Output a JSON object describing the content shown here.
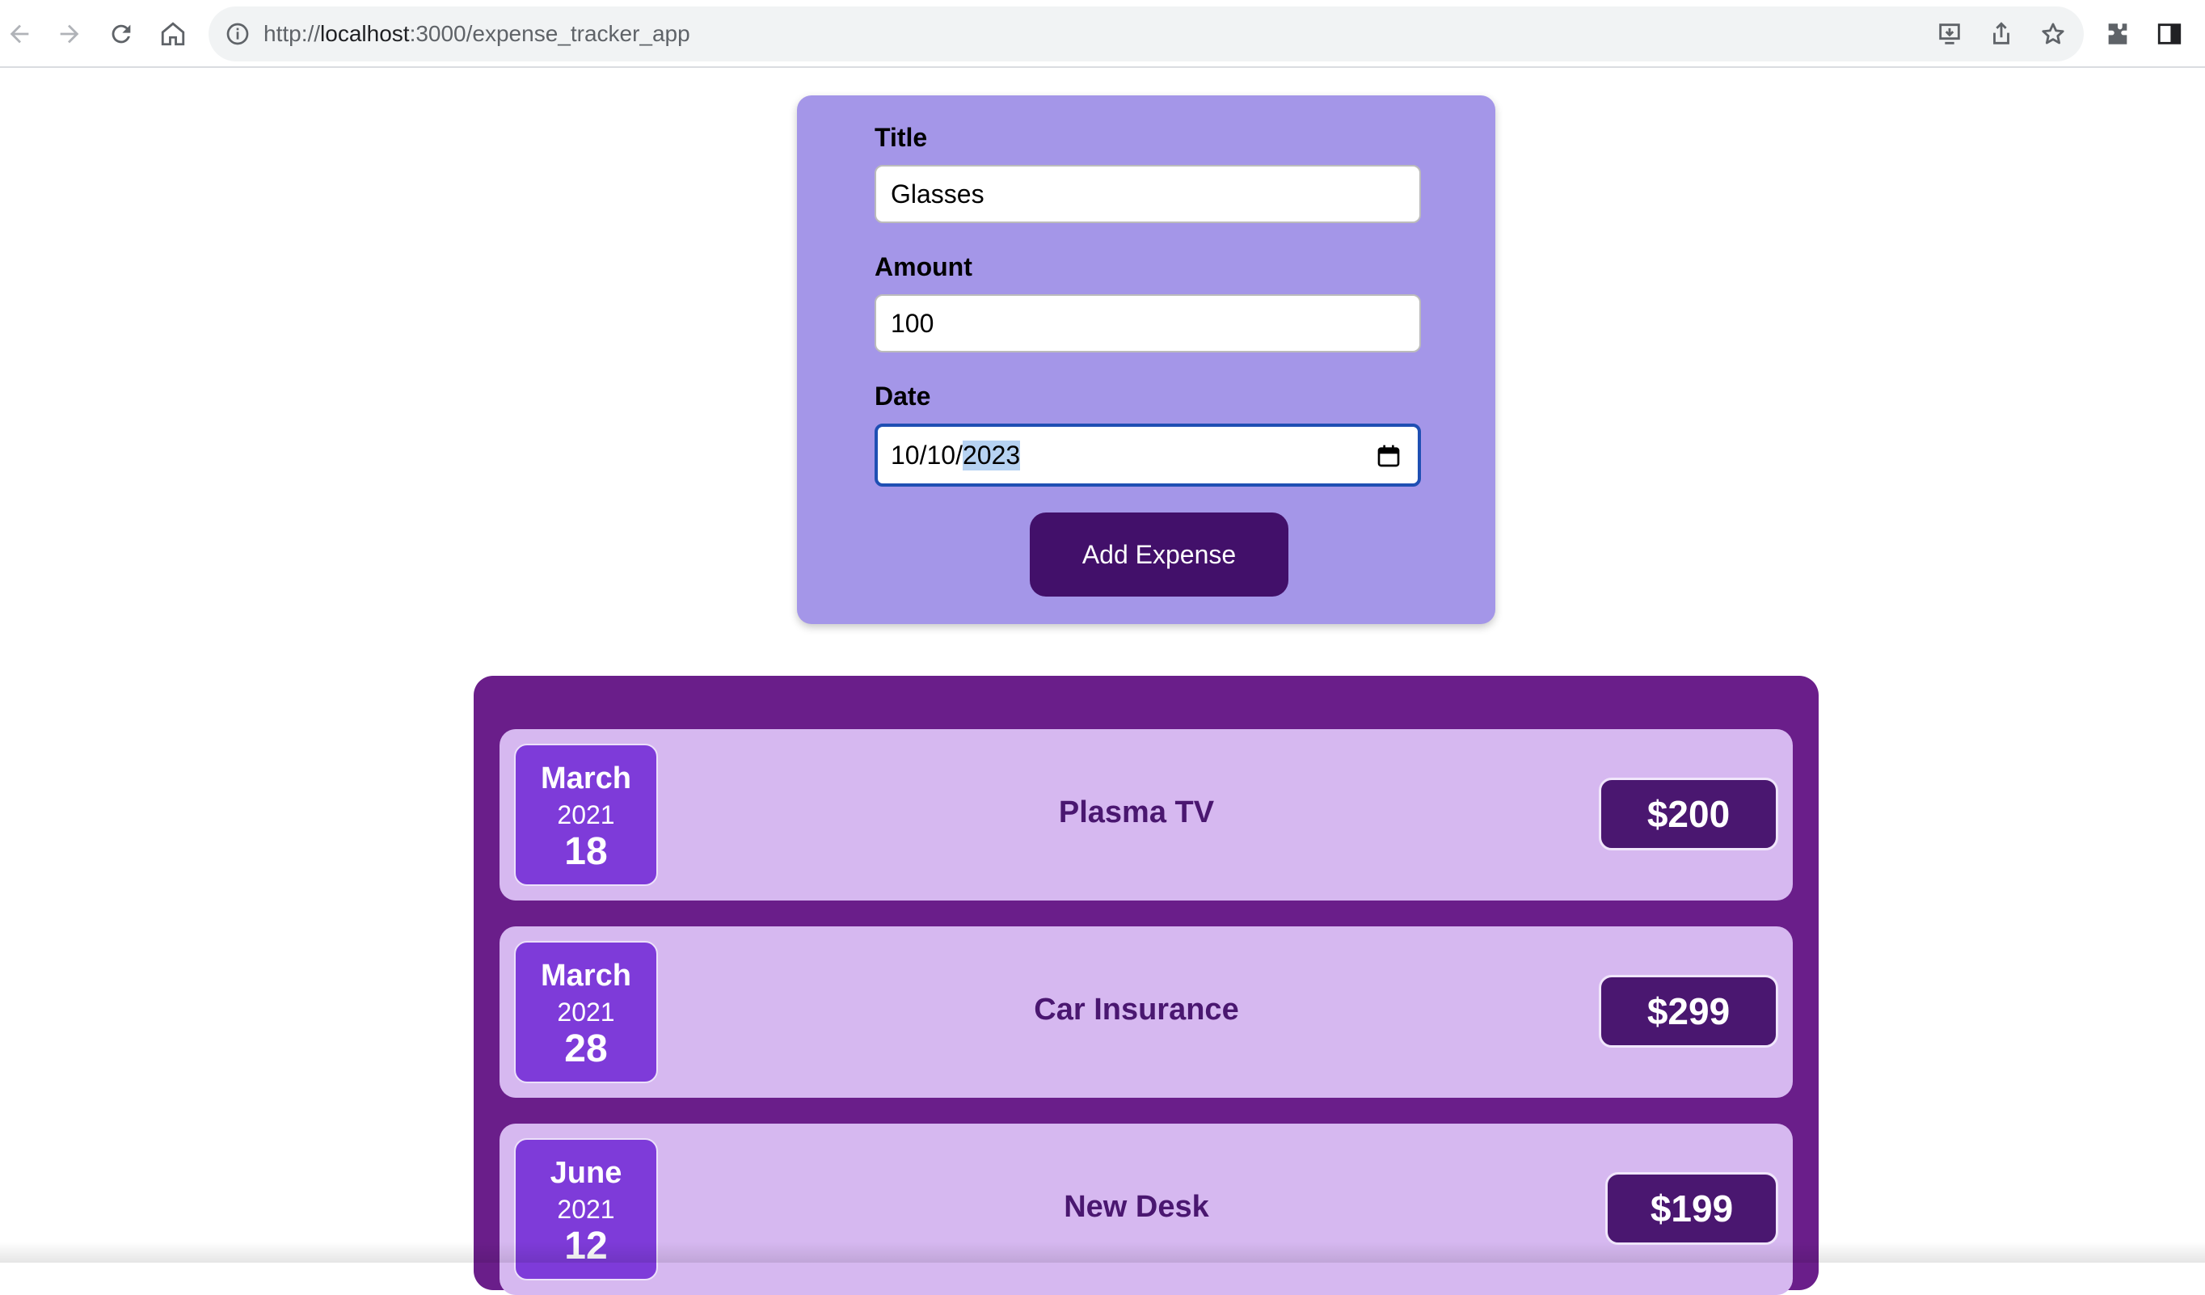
{
  "browser": {
    "url_scheme": "http://",
    "url_host": "localhost",
    "url_path": ":3000/expense_tracker_app",
    "icons": [
      "back-icon",
      "forward-icon",
      "reload-icon",
      "home-icon",
      "info-icon",
      "install-icon",
      "share-icon",
      "bookmark-star-icon",
      "extensions-icon",
      "side-panel-icon"
    ]
  },
  "form": {
    "title_label": "Title",
    "title_value": "Glasses",
    "amount_label": "Amount",
    "amount_value": "100",
    "date_label": "Date",
    "date_prefix": "10/10/",
    "date_selected": "2023",
    "submit_label": "Add Expense"
  },
  "expenses": [
    {
      "month": "March",
      "year": "2021",
      "day": "18",
      "title": "Plasma TV",
      "amount": "$200"
    },
    {
      "month": "March",
      "year": "2021",
      "day": "28",
      "title": "Car Insurance",
      "amount": "$299"
    },
    {
      "month": "June",
      "year": "2021",
      "day": "12",
      "title": "New Desk",
      "amount": "$199"
    }
  ],
  "colors": {
    "form_bg": "#a496e8",
    "button_bg": "#42106a",
    "list_bg": "#6a1e8a",
    "item_bg": "#d6b8f0",
    "date_box_bg": "#7e3bd9",
    "price_bg": "#4a1770"
  }
}
